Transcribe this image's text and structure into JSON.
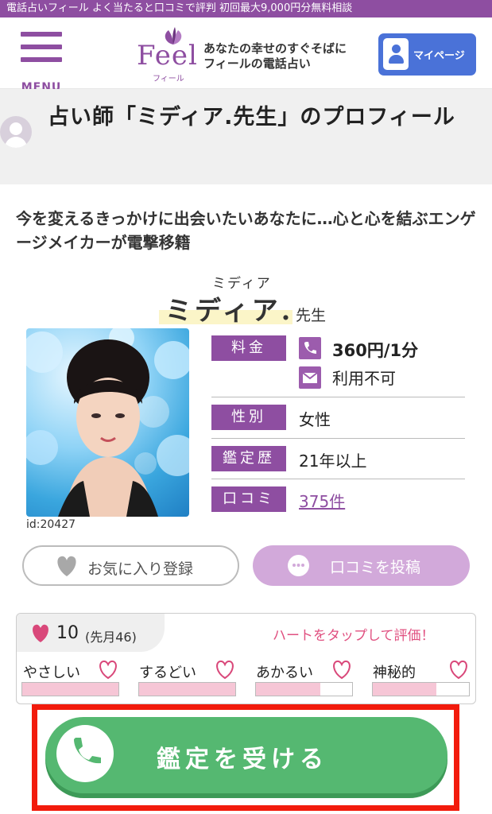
{
  "topbar": {
    "text": "電話占いフィール よく当たると口コミで評判 初回最大9,000円分無料相談"
  },
  "header": {
    "menu_label": "MENU",
    "logo_text": "Feel",
    "logo_sub": "フィール",
    "tagline_line1": "あなたの幸せのすぐそばに",
    "tagline_line2": "フィールの電話占い",
    "mypage_label": "マイページ"
  },
  "page": {
    "title": "占い師「ミディア.先生」のプロフィール"
  },
  "profile": {
    "catchphrase": "今を変えるきっかけに出会いたいあなたに…心と心を結ぶエンゲージメイカーが電撃移籍",
    "name_kana": "ミディア",
    "name": "ミディア.",
    "honorific": "先生",
    "id_text": "id:20427",
    "specs": {
      "fee_label": "料金",
      "fee_phone": "360円/1分",
      "fee_mail": "利用不可",
      "gender_label": "性別",
      "gender": "女性",
      "experience_label": "鑑定歴",
      "experience": "21年以上",
      "reviews_label": "口コミ",
      "reviews": "375件"
    }
  },
  "actions": {
    "favorite_label": "お気に入り登録",
    "post_review_label": "口コミを投稿"
  },
  "rating": {
    "likes": "10",
    "likes_last_month": "(先月46)",
    "hint": "ハートをタップして評価！",
    "criteria": [
      {
        "label": "やさしい",
        "level": 1.0
      },
      {
        "label": "するどい",
        "level": 1.0
      },
      {
        "label": "あかるい",
        "level": 0.67
      },
      {
        "label": "神秘的",
        "level": 0.66
      }
    ]
  },
  "cta": {
    "label": "鑑定を受ける"
  },
  "colors": {
    "brand_purple": "#8e4ea1",
    "mypage_blue": "#4a72d8",
    "cta_green": "#55b871",
    "highlight_red": "#f21b0c",
    "heart_pink": "#e05080"
  }
}
